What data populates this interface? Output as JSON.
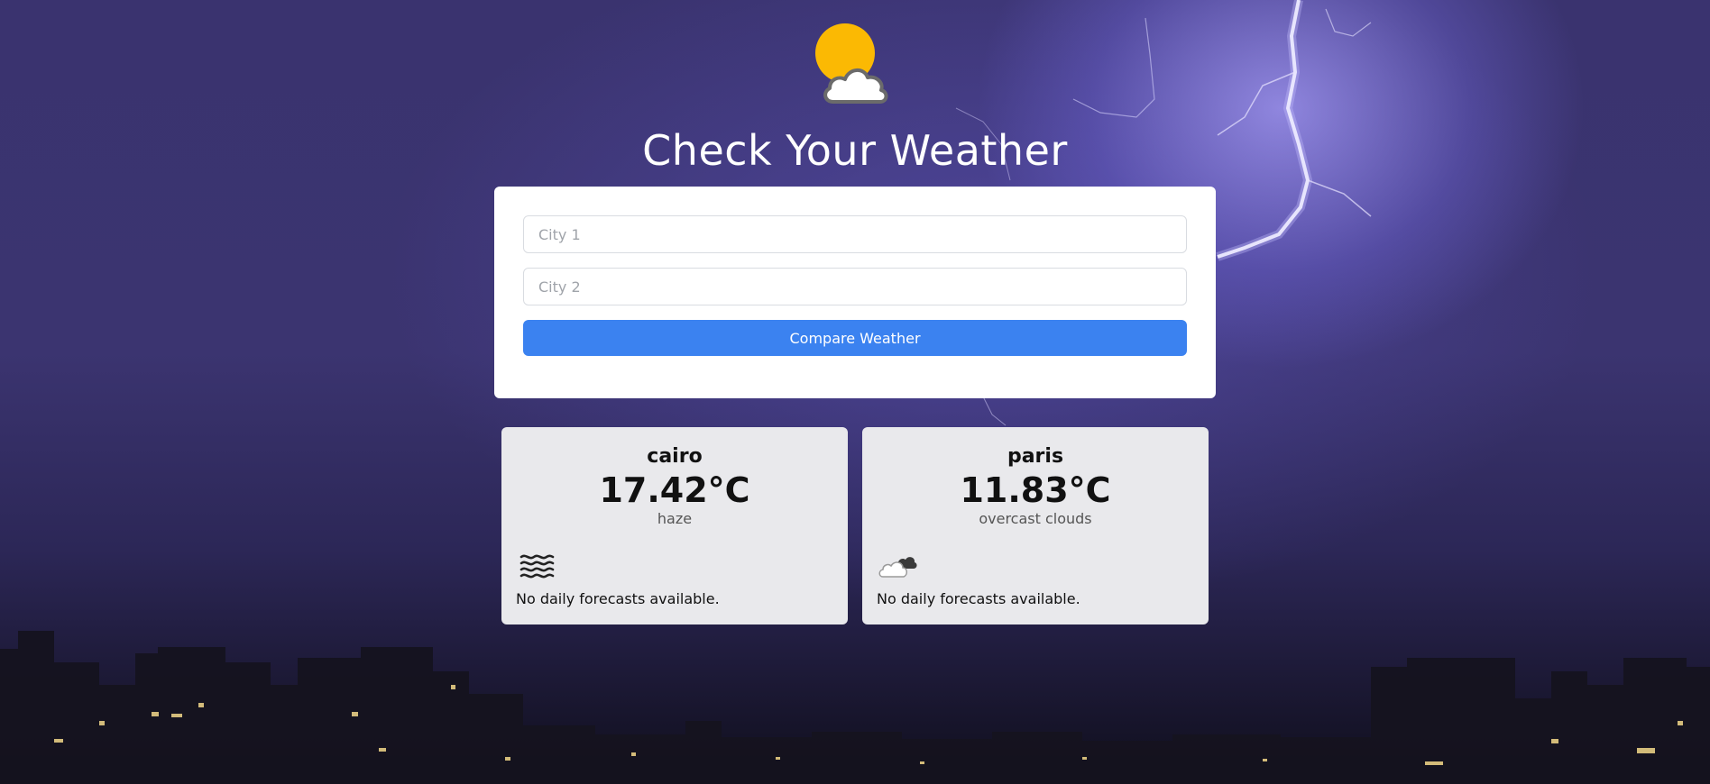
{
  "app": {
    "title": "Check Your Weather",
    "logo_icon": "sun-behind-cloud-icon",
    "colors": {
      "accent": "#3b82f0",
      "sun": "#fbb903",
      "card_bg": "#e9e9ec",
      "sky": "#3a336f"
    }
  },
  "form": {
    "city1_placeholder": "City 1",
    "city1_value": "",
    "city2_placeholder": "City 2",
    "city2_value": "",
    "compare_label": "Compare Weather"
  },
  "results": [
    {
      "city": "cairo",
      "temperature": "17.42°C",
      "description": "haze",
      "icon": "haze-icon",
      "forecast_note": "No daily forecasts available."
    },
    {
      "city": "paris",
      "temperature": "11.83°C",
      "description": "overcast clouds",
      "icon": "overcast-clouds-icon",
      "forecast_note": "No daily forecasts available."
    }
  ]
}
